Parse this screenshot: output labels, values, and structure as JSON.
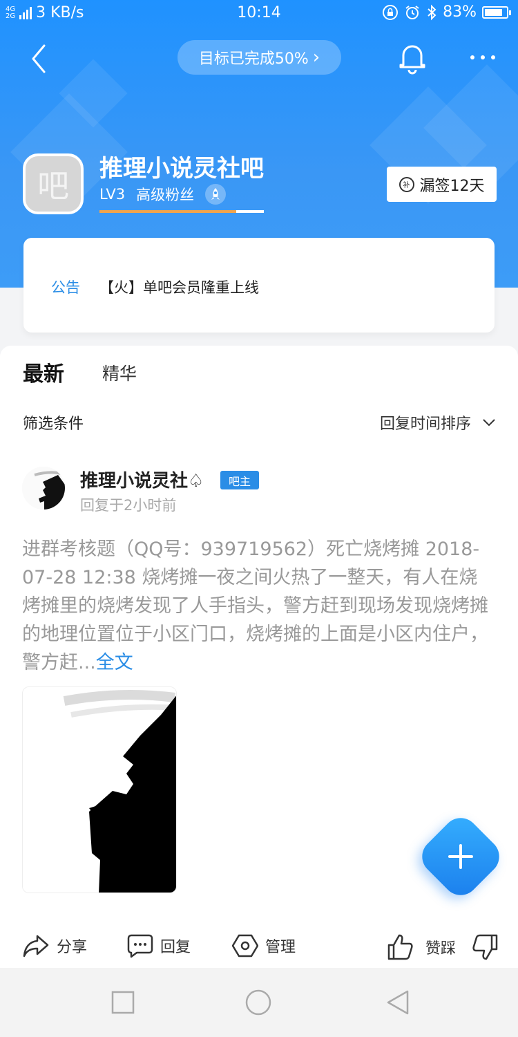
{
  "status_bar": {
    "network_top": "4G",
    "network_bottom": "2G",
    "speed": "3 KB/s",
    "time": "10:14",
    "battery": "83%",
    "battery_level": 0.83
  },
  "header": {
    "goal_text": "目标已完成50%",
    "goal_chevron": "›"
  },
  "forum": {
    "avatar_char": "吧",
    "name": "推理小说灵社吧",
    "level": "LV3",
    "rank": "高级粉丝",
    "level_progress": 0.83,
    "sign_label": "漏签12天",
    "sign_icon_char": "补"
  },
  "notice": {
    "tag": "公告",
    "text": "【火】单吧会员隆重上线"
  },
  "tabs": {
    "latest": "最新",
    "featured": "精华"
  },
  "filter": {
    "label": "筛选条件",
    "sort": "回复时间排序"
  },
  "post": {
    "author": "推理小说灵社♤",
    "badge": "吧主",
    "time": "回复于2小时前",
    "body": "进群考核题（QQ号：939719562）死亡烧烤摊 2018-07-28 12:38 烧烤摊一夜之间火热了一整天，有人在烧烤摊里的烧烤发现了人手指头，警方赶到现场发现烧烤摊的地理位置位于小区门口，烧烤摊的上面是小区内住户，警方赶...",
    "read_more": "全文"
  },
  "actions": {
    "share": "分享",
    "reply": "回复",
    "manage": "管理",
    "vote": "赞踩"
  },
  "colors": {
    "brand_blue": "#2a8de6",
    "header_blue": "#1f92ff",
    "progress_orange": "#f0a44d"
  },
  "icons": [
    "back-icon",
    "bell-icon",
    "more-icon",
    "rocket-icon",
    "share-icon",
    "reply-icon",
    "manage-icon",
    "thumbs-up-icon",
    "thumbs-down-icon",
    "plus-icon",
    "chevron-down-icon"
  ]
}
